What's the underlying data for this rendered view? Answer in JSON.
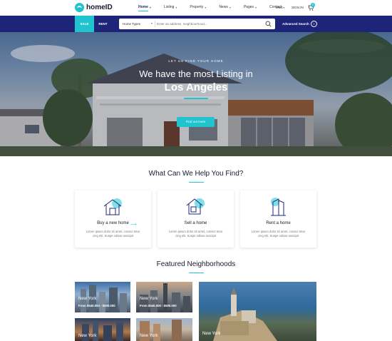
{
  "logo": {
    "text": "home",
    "bold": "ID"
  },
  "nav": {
    "items": [
      {
        "label": "Home",
        "active": true
      },
      {
        "label": "Listing",
        "active": false
      },
      {
        "label": "Property",
        "active": false
      },
      {
        "label": "News",
        "active": false
      },
      {
        "label": "Pages",
        "active": false
      },
      {
        "label": "Contact",
        "active": false
      }
    ],
    "lang": "ENG",
    "signin": "SIGN IN",
    "cart_count": "0"
  },
  "search": {
    "tab_sale": "SALE",
    "tab_rent": "RENT",
    "type_label": "Home Types",
    "placeholder": "Enter an address, neighbourhood...",
    "advanced": "Advanced Search"
  },
  "hero": {
    "eyebrow": "LET US FIND YOUR HOME",
    "title": "We have the most Listing in",
    "city": "Los Angeles",
    "button": "Find out more"
  },
  "help": {
    "title": "What Can We Help You Find?",
    "cards": [
      {
        "title": "Buy a new home",
        "text": "Lorem ipsum dolor sit amet, consec tetur cing elit. Suspe ndisse suscipit"
      },
      {
        "title": "Sell a home",
        "text": "Lorem ipsum dolor sit amet, consec tetur cing elit. Suspe ndisse suscipit"
      },
      {
        "title": "Rent a home",
        "text": "Lorem ipsum dolor sit amet, consec tetur cing elit. Suspe ndisse suscipit"
      }
    ]
  },
  "featured": {
    "title": "Featured Neighborhoods",
    "items": [
      {
        "name": "New York",
        "price": "From $540.000 - $500.000"
      },
      {
        "name": "New York",
        "price": "From $540.000 - $500.000"
      },
      {
        "name": "New York",
        "price": ""
      },
      {
        "name": "New York",
        "price": ""
      },
      {
        "name": "New York",
        "price": ""
      }
    ]
  },
  "colors": {
    "accent": "#1fc4cf",
    "navy": "#1e2478",
    "dark": "#1a1a2e"
  }
}
